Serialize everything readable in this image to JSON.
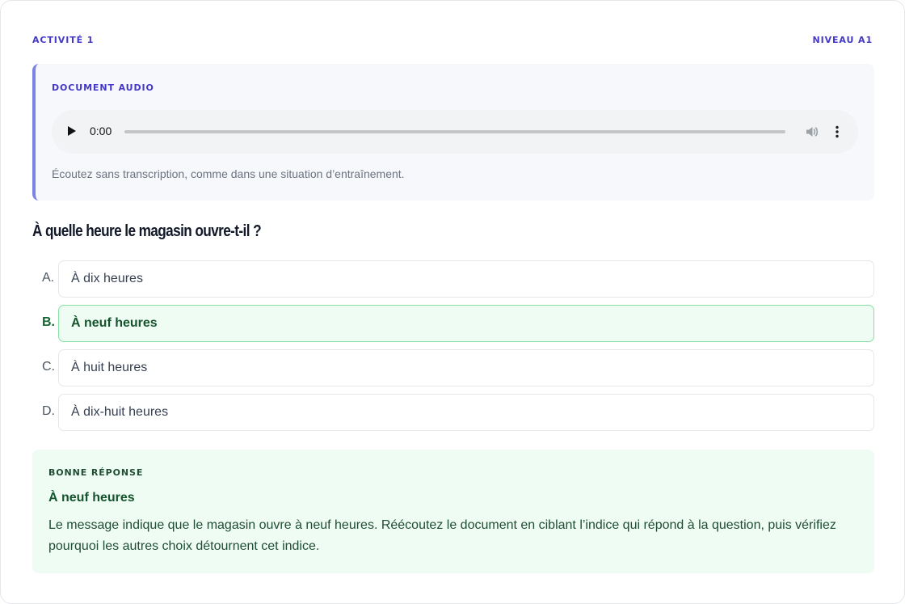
{
  "header": {
    "activity": "ACTIVITÉ 1",
    "level": "NIVEAU A1"
  },
  "audio": {
    "label": "DOCUMENT AUDIO",
    "time": "0:00",
    "progress": 0,
    "note": "Écoutez sans transcription, comme dans une situation d’entraînement."
  },
  "question": "À quelle heure le magasin ouvre-t-il ?",
  "options": [
    {
      "letter": "A.",
      "text": "À dix heures"
    },
    {
      "letter": "B.",
      "text": "À neuf heures"
    },
    {
      "letter": "C.",
      "text": "À huit heures"
    },
    {
      "letter": "D.",
      "text": "À dix-huit heures"
    }
  ],
  "selected_option": "B",
  "feedback": {
    "label": "BONNE RÉPONSE",
    "answer": "À neuf heures",
    "explanation": "Le message indique que le magasin ouvre à neuf heures. Réécoutez le document en ciblant l’indice qui répond à la question, puis vérifiez pourquoi les autres choix détournent cet indice."
  },
  "colors": {
    "accent": "#4338ca",
    "panel_border": "#7c83e6",
    "correct_bg": "#effcf3",
    "correct_border": "#86e2a4",
    "correct_text": "#14532d"
  },
  "icons": {
    "play": "play-icon",
    "volume": "volume-icon",
    "more": "more-vertical-icon"
  }
}
